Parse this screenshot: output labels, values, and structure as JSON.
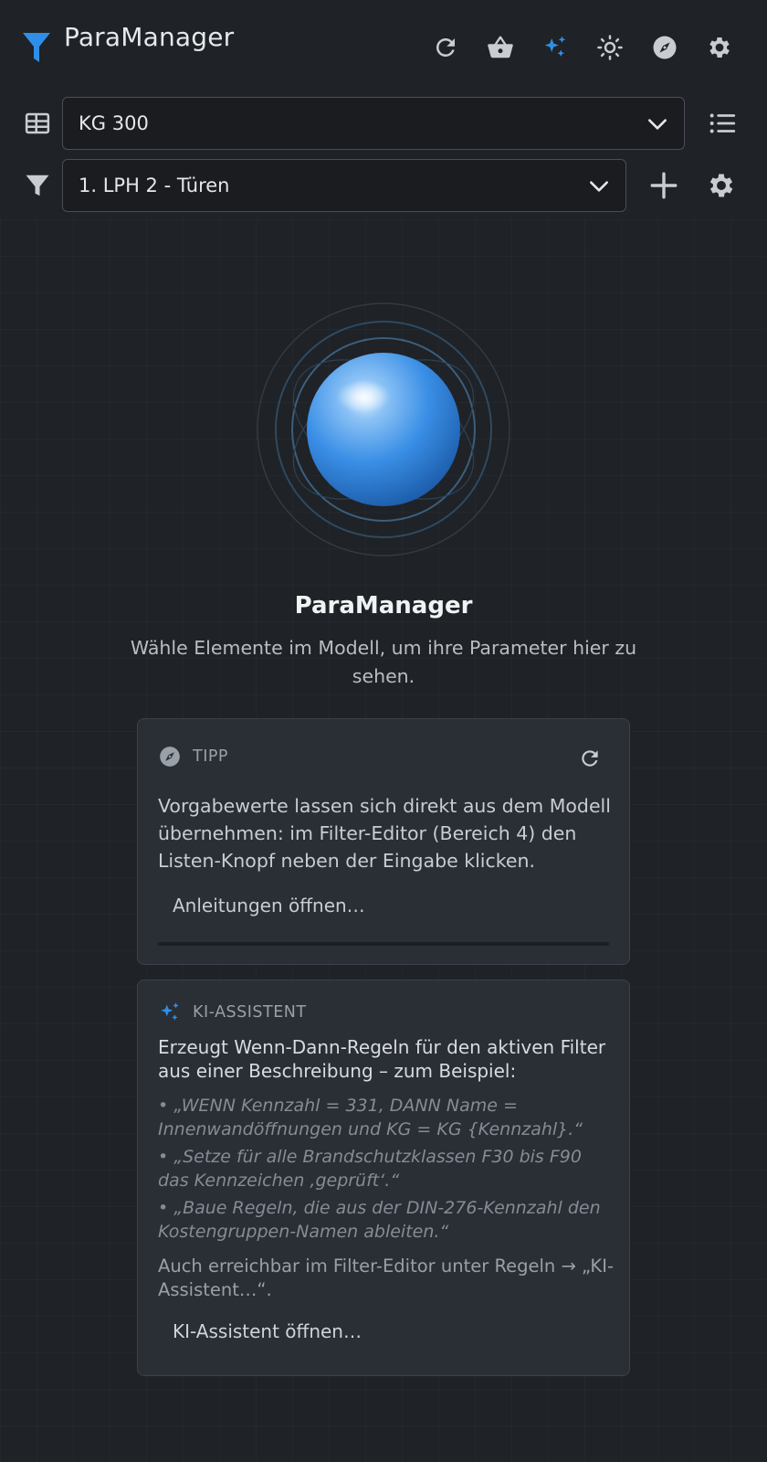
{
  "header": {
    "title": "ParaManager",
    "toolbar": [
      "refresh-icon",
      "basket-icon",
      "sparkle-icon",
      "brightness-icon",
      "compass-icon",
      "gear-icon"
    ]
  },
  "colors": {
    "accent": "#2f8fe8",
    "background": "#1f2226",
    "card": "#2a2e35"
  },
  "selectors": {
    "category": {
      "value": "KG 300"
    },
    "filter": {
      "value": "1. LPH 2 - Türen"
    }
  },
  "empty_state": {
    "title": "ParaManager",
    "subtitle": "Wähle Elemente im Modell, um ihre Parameter hier zu sehen."
  },
  "tip_card": {
    "label": "TIPP",
    "text": "Vorgabewerte lassen sich direkt aus dem Modell übernehmen: im Filter-Editor (Bereich 4) den Listen-Knopf neben der Eingabe klicken.",
    "link": "Anleitungen öffnen…",
    "progress": 0
  },
  "ki_card": {
    "label": "KI-ASSISTENT",
    "intro": "Erzeugt Wenn-Dann-Regeln für den aktiven Filter aus einer Beschreibung – zum Beispiel:",
    "examples": [
      "• „WENN Kennzahl = 331, DANN Name = Innenwandöffnungen und KG = KG {Kennzahl}.“",
      "• „Setze für alle Brandschutzklassen F30 bis F90 das Kennzeichen ‚geprüft‘.“",
      "• „Baue Regeln, die aus der DIN-276-Kennzahl den Kostengruppen-Namen ableiten.“"
    ],
    "note": "Auch erreichbar im Filter-Editor unter Regeln → „KI-Assistent…“.",
    "link": "KI-Assistent öffnen…"
  }
}
